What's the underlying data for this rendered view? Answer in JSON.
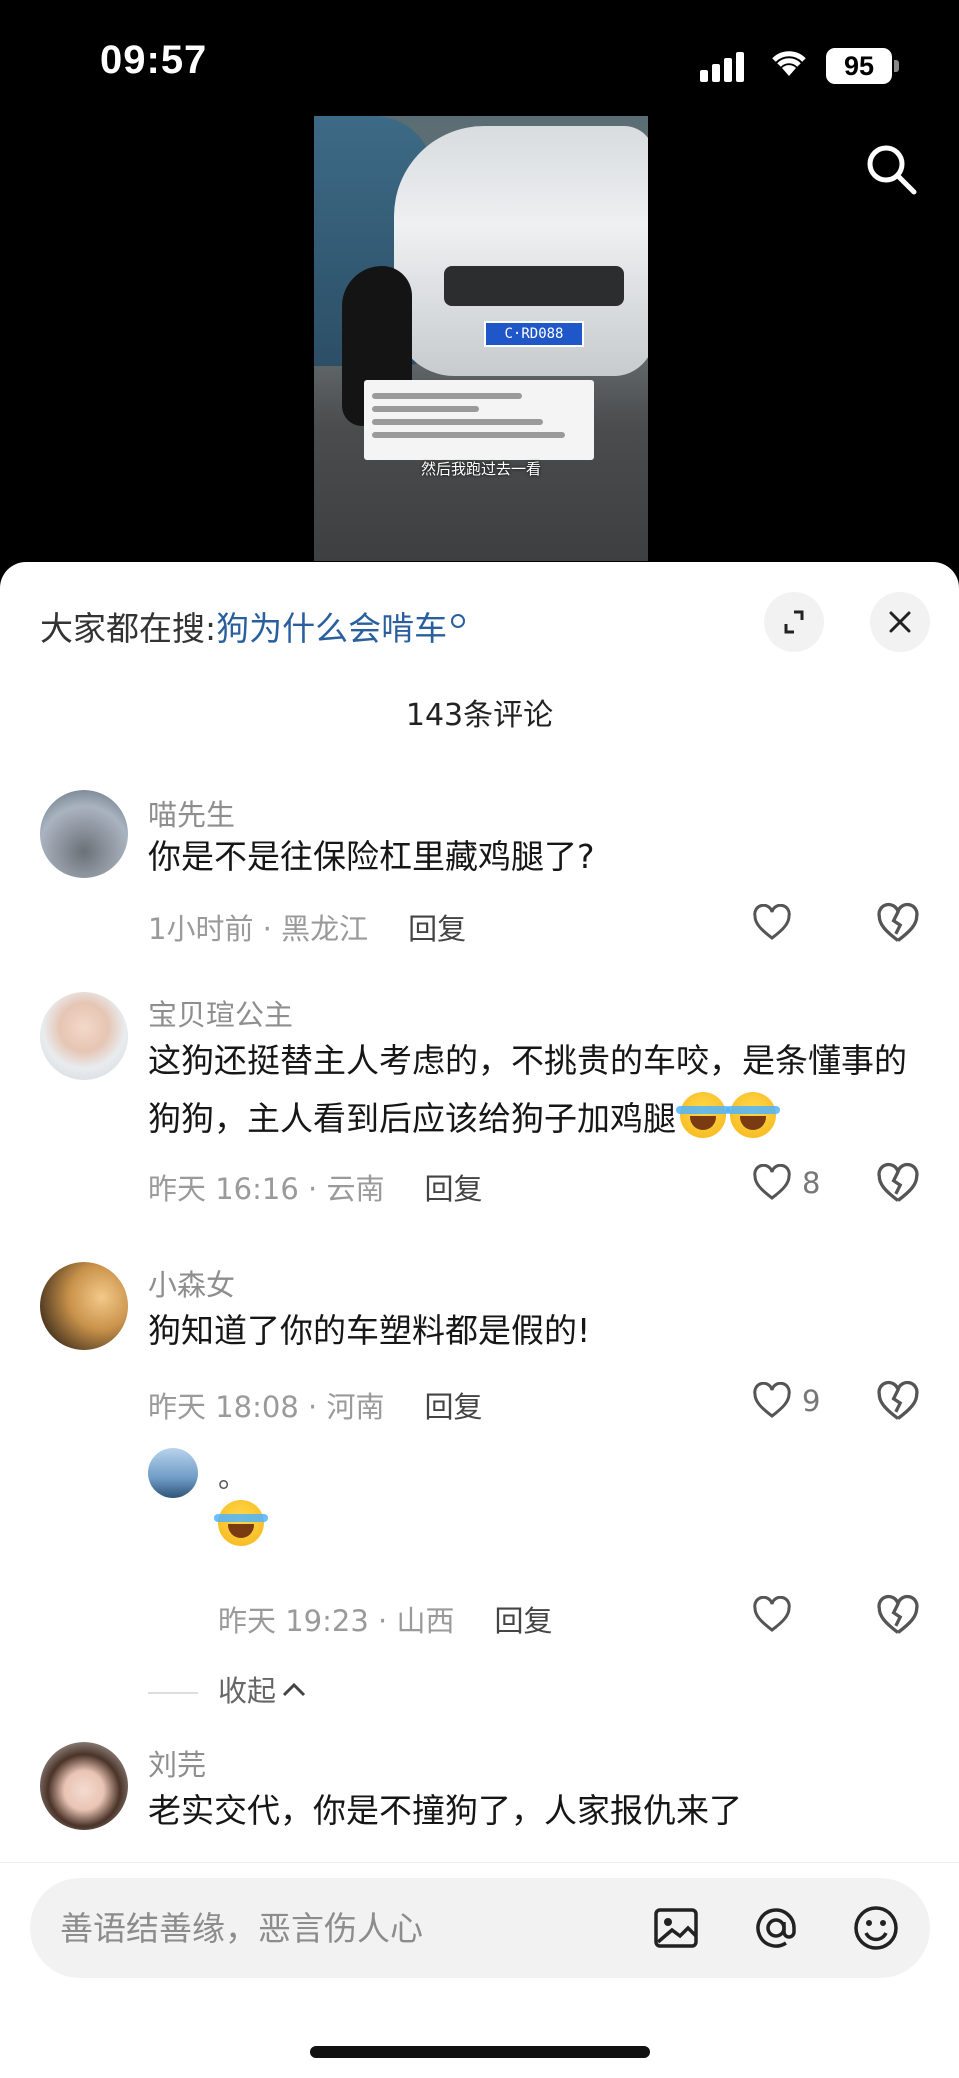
{
  "status_bar": {
    "time": "09:57",
    "battery": "95"
  },
  "video": {
    "plate": "C·RD088",
    "subtitle": "然后我跑过去一看"
  },
  "search_suggestion": {
    "prefix": "大家都在搜:",
    "keyword": "狗为什么会啃车"
  },
  "comment_count_label": "143条评论",
  "comments": [
    {
      "user": "喵先生",
      "text": "你是不是往保险杠里藏鸡腿了?",
      "time": "1小时前 · 黑龙江",
      "reply_label": "回复",
      "likes": ""
    },
    {
      "user": "宝贝瑄公主",
      "text": "这狗还挺替主人考虑的，不挑贵的车咬，是条懂事的狗狗，主人看到后应该给狗子加鸡腿",
      "time": "昨天 16:16 · 云南",
      "reply_label": "回复",
      "likes": "8"
    },
    {
      "user": "小森女",
      "text": "狗知道了你的车塑料都是假的!",
      "time": "昨天 18:08 · 河南",
      "reply_label": "回复",
      "likes": "9"
    },
    {
      "user": "刘芫",
      "text": "老实交代，你是不撞狗了，人家报仇来了",
      "time": "",
      "reply_label": "",
      "likes": ""
    }
  ],
  "reply": {
    "user": "。",
    "time": "昨天 19:23 · 山西",
    "reply_label": "回复"
  },
  "collapse_label": "收起",
  "input": {
    "placeholder": "善语结善缘，恶言伤人心"
  },
  "colors": {
    "keyword": "#2a5f9e",
    "sheet_bg": "#ffffff",
    "input_bg": "#f2f2f2"
  },
  "icons": [
    "search-icon",
    "expand-icon",
    "close-icon",
    "heart-icon",
    "broken-heart-icon",
    "image-icon",
    "at-icon",
    "emoji-icon"
  ]
}
